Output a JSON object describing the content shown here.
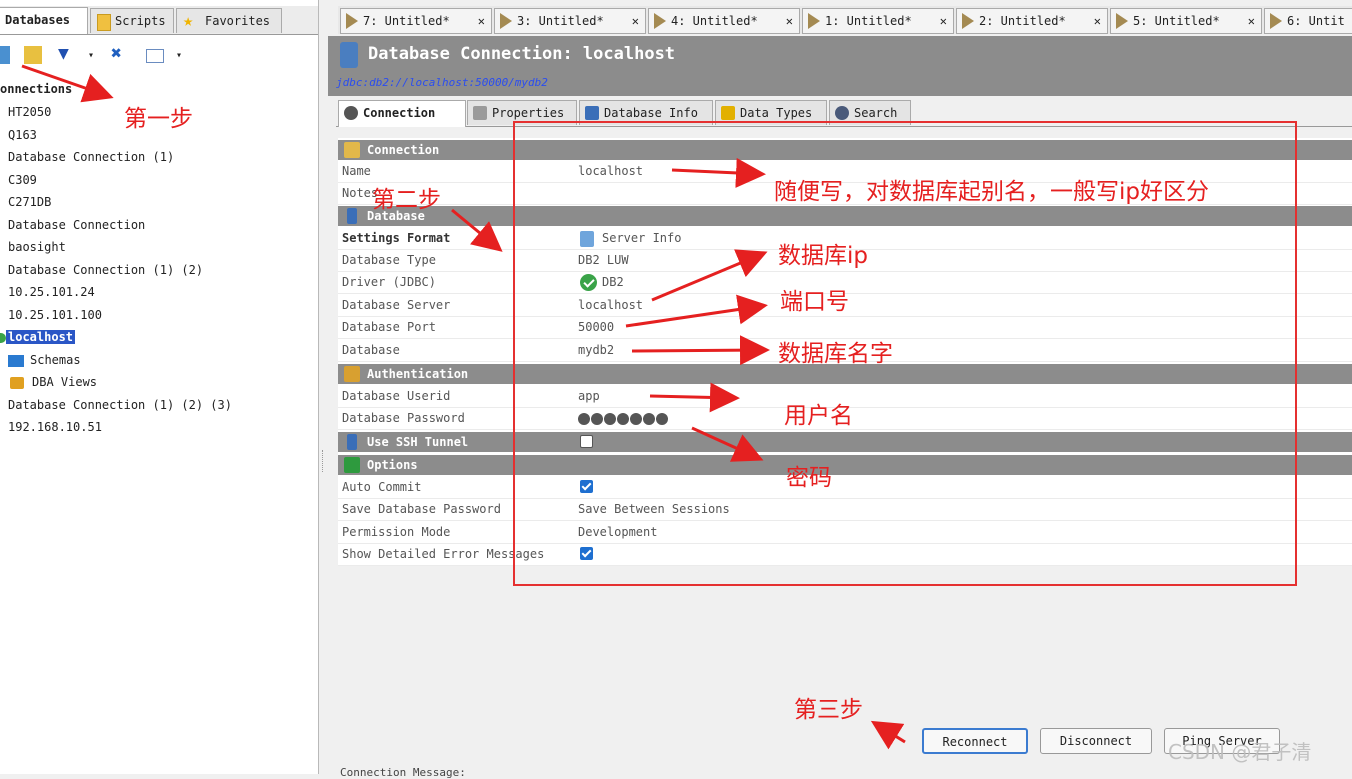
{
  "left_panel": {
    "tabs": [
      "Databases",
      "Scripts",
      "Favorites"
    ],
    "section_title": "onnections",
    "connections": [
      "HT2050",
      "Q163",
      "Database Connection (1)",
      "C309",
      "C271DB",
      "Database Connection",
      "baosight",
      "Database Connection (1) (2)",
      "10.25.101.24",
      "10.25.101.100",
      "localhost"
    ],
    "children": [
      "Schemas",
      "DBA Views"
    ],
    "after_children": [
      "Database Connection (1) (2) (3)",
      "192.168.10.51"
    ]
  },
  "editor_tabs": [
    {
      "label": "7: Untitled*",
      "close": "✕"
    },
    {
      "label": "3: Untitled*",
      "close": "✕"
    },
    {
      "label": "4: Untitled*",
      "close": "✕"
    },
    {
      "label": "1: Untitled*",
      "close": "✕"
    },
    {
      "label": "2: Untitled*",
      "close": "✕"
    },
    {
      "label": "5: Untitled*",
      "close": "✕"
    },
    {
      "label": "6: Untit",
      "close": ""
    }
  ],
  "header": {
    "title": "Database Connection: localhost",
    "url": "jdbc:db2://localhost:50000/mydb2"
  },
  "sub_tabs": [
    "Connection",
    "Properties",
    "Database Info",
    "Data Types",
    "Search"
  ],
  "form": {
    "sec_connection": "Connection",
    "name_label": "Name",
    "name_value": "localhost",
    "notes_label": "Notes",
    "sec_database": "Database",
    "settings_format_label": "Settings Format",
    "settings_format_value": "Server Info",
    "db_type_label": "Database Type",
    "db_type_value": "DB2 LUW",
    "driver_label": "Driver (JDBC)",
    "driver_value": "DB2",
    "server_label": "Database Server",
    "server_value": "localhost",
    "port_label": "Database Port",
    "port_value": "50000",
    "database_label": "Database",
    "database_value": "mydb2",
    "sec_auth": "Authentication",
    "userid_label": "Database Userid",
    "userid_value": "app",
    "password_label": "Database Password",
    "password_dots": 7,
    "sec_ssh": "Use SSH Tunnel",
    "ssh_checked": false,
    "sec_options": "Options",
    "auto_commit_label": "Auto Commit",
    "auto_commit_checked": true,
    "save_pw_label": "Save Database Password",
    "save_pw_value": "Save Between Sessions",
    "permission_label": "Permission Mode",
    "permission_value": "Development",
    "show_errors_label": "Show Detailed Error Messages",
    "show_errors_checked": true
  },
  "buttons": {
    "reconnect": "Reconnect",
    "disconnect": "Disconnect",
    "ping": "Ping Server"
  },
  "connection_message_label": "Connection Message:",
  "annotations": {
    "step1": "第一步",
    "step2": "第二步",
    "step3": "第三步",
    "name_note": "随便写，对数据库起别名，一般写ip好区分",
    "server_note": "数据库ip",
    "port_note": "端口号",
    "database_note": "数据库名字",
    "userid_note": "用户名",
    "password_note": "密码"
  },
  "watermark": "CSDN @君子清",
  "colors": {
    "annotation": "#e52020",
    "section_header": "#8c8c8c",
    "selection": "#2a56c6",
    "checkbox": "#1e6fd0",
    "url": "#2a4df0"
  }
}
